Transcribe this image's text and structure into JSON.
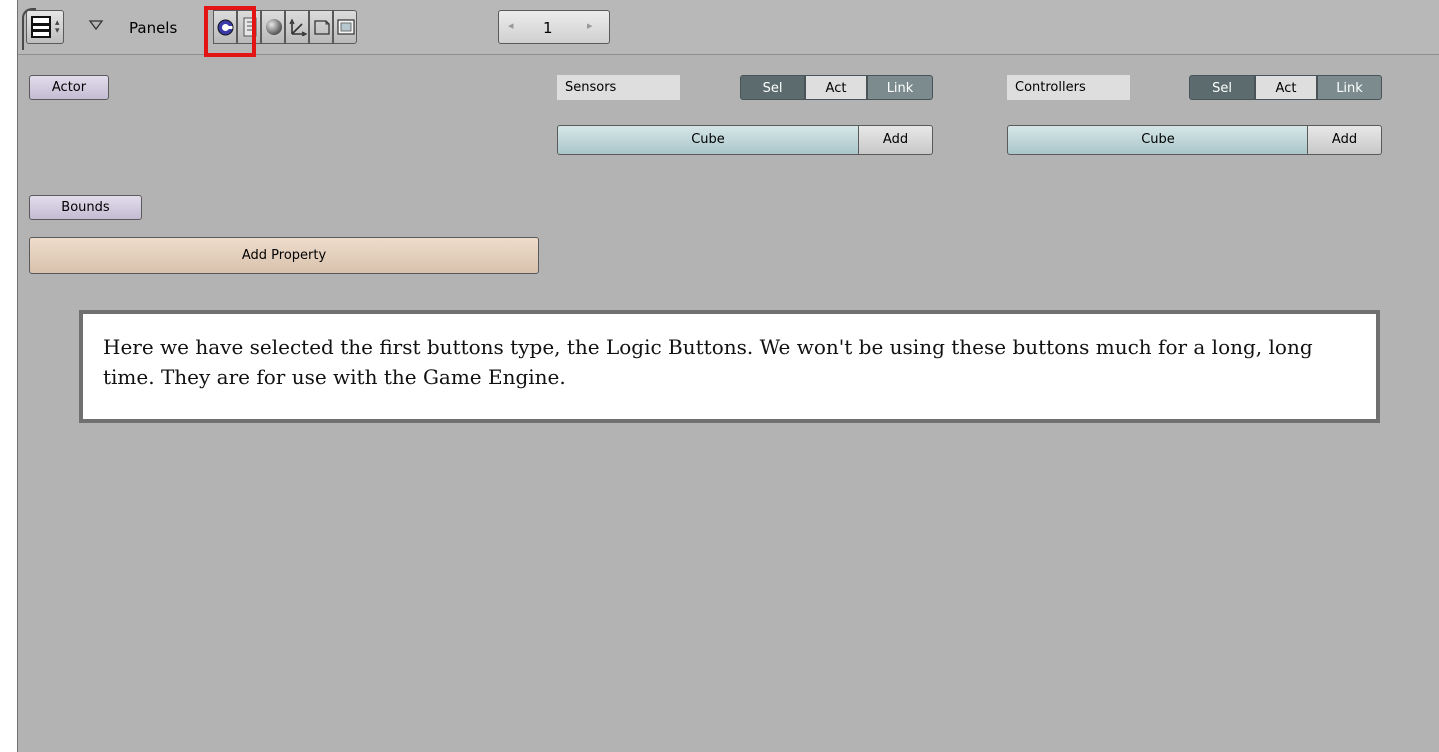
{
  "header": {
    "panels_label": "Panels",
    "page_number": "1",
    "icons": [
      "window-type-icon",
      "menu-updown-icon",
      "collapse-triangle-icon",
      "logic-buttons-icon",
      "script-buttons-icon",
      "shading-buttons-icon",
      "object-buttons-icon",
      "editing-buttons-icon",
      "scene-buttons-icon",
      "prev-page-icon",
      "next-page-icon"
    ],
    "highlight_color": "#e31414"
  },
  "left": {
    "actor_label": "Actor",
    "bounds_label": "Bounds",
    "add_property_label": "Add Property"
  },
  "sensors": {
    "title": "Sensors",
    "sel": "Sel",
    "act": "Act",
    "link": "Link",
    "object": "Cube",
    "add": "Add"
  },
  "controllers": {
    "title": "Controllers",
    "sel": "Sel",
    "act": "Act",
    "link": "Link",
    "object": "Cube",
    "add": "Add"
  },
  "note": {
    "text": "Here we have selected the first buttons type, the Logic Buttons. We won't be using these buttons much for a long, long time. They are for use with the Game Engine."
  }
}
